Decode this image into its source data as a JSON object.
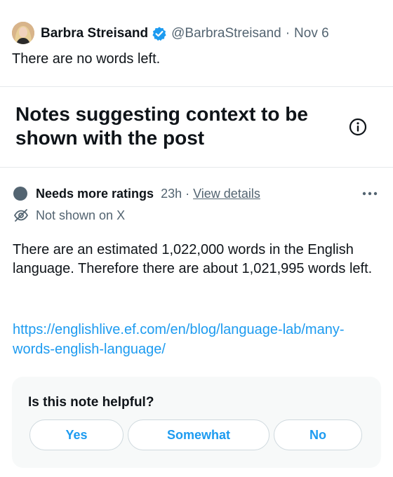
{
  "post": {
    "author_name": "Barbra Streisand",
    "handle": "@BarbraStreisand",
    "separator": "·",
    "date": "Nov 6",
    "text": "There are no words left.",
    "avatar_icon": "profile-photo",
    "verified_icon": "verified-badge-icon",
    "verified_color": "#1d9bf0"
  },
  "notes_section": {
    "title": "Notes suggesting context to be shown with the post",
    "info_icon": "info-icon"
  },
  "note": {
    "status_label": "Needs more ratings",
    "time": "23h",
    "separator": "·",
    "view_details": "View details",
    "not_shown": "Not shown on X",
    "text": "There are an estimated 1,022,000 words in the English language. Therefore there are about 1,021,995 words left.",
    "link": "https://englishlive.ef.com/en/blog/language-lab/many-words-english-language/",
    "more_icon": "more-horizontal-icon",
    "eye_icon": "eye-off-icon"
  },
  "helpful": {
    "question": "Is this note helpful?",
    "buttons": {
      "yes": "Yes",
      "somewhat": "Somewhat",
      "no": "No"
    }
  },
  "colors": {
    "accent": "#1d9bf0",
    "text_primary": "#0f1419",
    "text_secondary": "#536471",
    "panel_background": "#f7f9f9"
  }
}
